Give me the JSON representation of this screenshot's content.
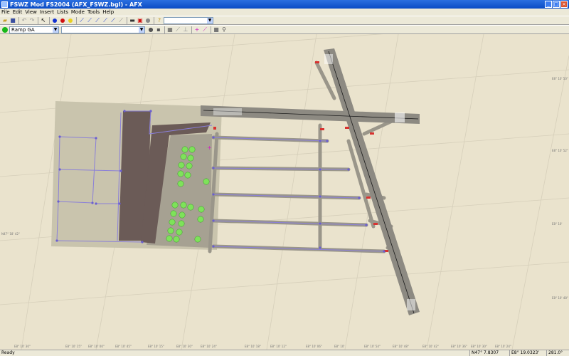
{
  "window": {
    "title": "FSWZ Mod FS2004 (AFX_FSWZ.bgl) - AFX",
    "buttons": {
      "minimize": "_",
      "maximize": "□",
      "close": "×"
    }
  },
  "menu": [
    "File",
    "Edit",
    "View",
    "Insert",
    "Lists",
    "Mode",
    "Tools",
    "Help"
  ],
  "toolbar2": {
    "ramp_select_value": "Ramp GA",
    "second_select_value": ""
  },
  "map": {
    "lat_labels": [
      "N47° 18' 00\"",
      "N47° 18' 42\""
    ],
    "lon_labels": [
      "E8° 10' 30\"",
      "E8° 10' 15\"",
      "E8° 10' 00\"",
      "E8° 10' 45\"",
      "E8° 10' 15\"",
      "E8° 10' 30\"",
      "E8° 10' 24\"",
      "E8° 10' 18\"",
      "E8° 10' 12\"",
      "E8° 10' 06\"",
      "E8° 10'",
      "E8° 10' 54\"",
      "E8° 10' 48\"",
      "E8° 10' 42\"",
      "E8° 10' 36\"",
      "E8° 10' 30\"",
      "E8° 10' 24\""
    ],
    "right_labels": [
      "E8° 10' 50\"",
      "E8° 10' 52\"",
      "E8° 10'",
      "E8° 10' 48\""
    ]
  },
  "status": {
    "ready": "Ready",
    "lat": "N47° 7.8307",
    "lon": "E8° 19.0323'",
    "heading": "281.0°"
  },
  "colors": {
    "ground": "#eae3cd",
    "apron_area": "#c9c4ad",
    "apron_hard": "#a6a192",
    "hangar": "#6b5b57",
    "taxiway": "#9a968a",
    "taxi_line": "#8a7fd8",
    "runway": "#8d8a82",
    "hold_short": "#d8322f",
    "parking": "#7ee25a"
  }
}
